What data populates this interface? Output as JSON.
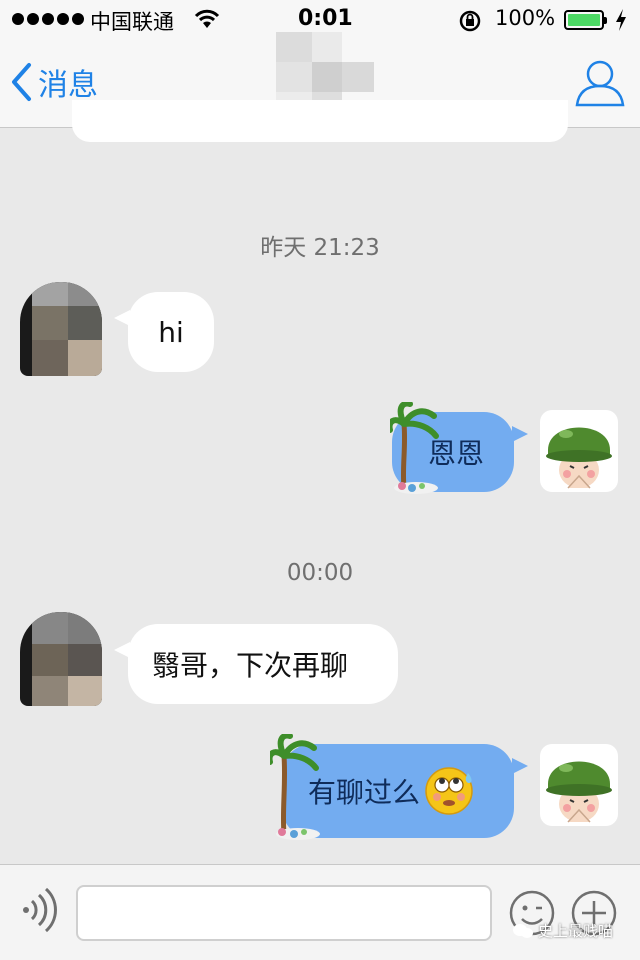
{
  "status_bar": {
    "carrier": "中国联通",
    "time": "0:01",
    "battery_percent": "100%",
    "battery_level": 1.0,
    "signal_dots": 5
  },
  "nav": {
    "back_label": "消息",
    "accent_color": "#1f82e6"
  },
  "messages": [
    {
      "type": "timestamp",
      "text": "昨天 21:23"
    },
    {
      "type": "incoming",
      "text": "hi"
    },
    {
      "type": "outgoing",
      "text": "恩恩"
    },
    {
      "type": "timestamp",
      "text": "00:00"
    },
    {
      "type": "incoming",
      "text": "翳哥，下次再聊"
    },
    {
      "type": "outgoing",
      "text": "有聊过么",
      "emoji": "sweating-rolling-eyes-emoji"
    }
  ],
  "input_bar": {
    "placeholder": "",
    "icons": [
      "voice-icon",
      "emoji-icon",
      "plus-icon"
    ]
  },
  "watermark": "史上最贱喵",
  "colors": {
    "outgoing_bubble": "#73acf0",
    "incoming_bubble": "#ffffff",
    "background": "#e9e9e9"
  }
}
